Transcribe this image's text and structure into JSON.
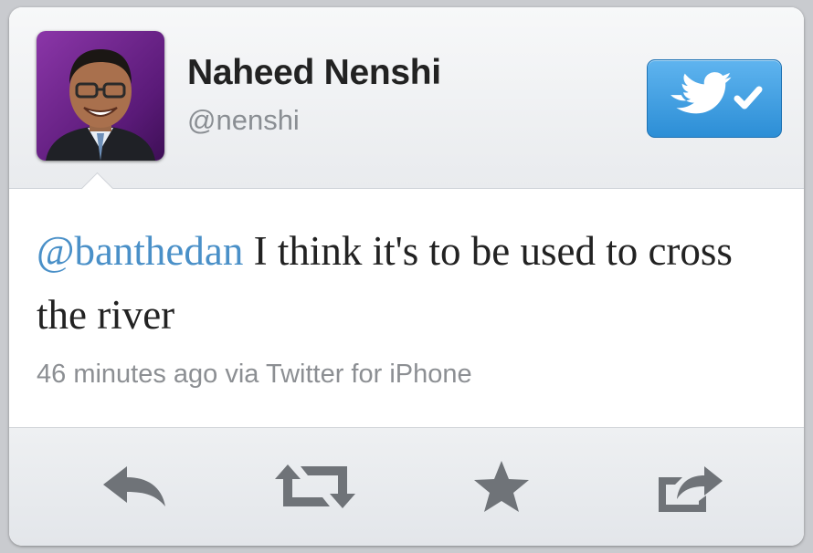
{
  "user": {
    "name": "Naheed Nenshi",
    "handle": "@nenshi"
  },
  "tweet": {
    "mention": "@banthedan",
    "text": " I think it's to be used to cross the river",
    "meta": "46 minutes ago via Twitter for iPhone"
  },
  "icons": {
    "follow": "twitter-bird-check-icon",
    "reply": "reply-icon",
    "retweet": "retweet-icon",
    "favorite": "star-icon",
    "share": "share-icon"
  },
  "colors": {
    "mention": "#4a90c8",
    "follow_button": "#2c8ed6",
    "action_icon": "#6f7378"
  }
}
